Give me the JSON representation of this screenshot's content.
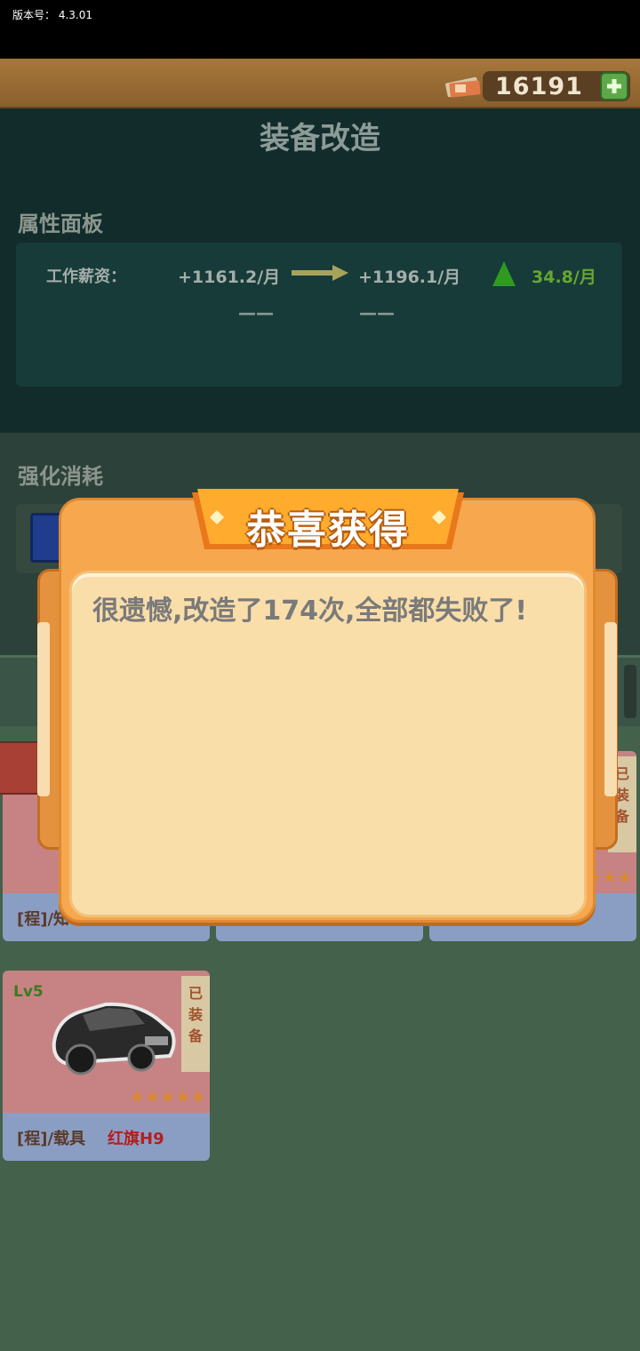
{
  "status": {
    "version_label": "版本号： 4.3.01"
  },
  "topbar": {
    "money": "16191"
  },
  "page": {
    "title": "装备改造"
  },
  "attributes": {
    "section_title": "属性面板",
    "label": "工作薪资：",
    "old_value": "+1161.2/月",
    "new_value": "+1196.1/月",
    "diff": "34.8/月",
    "dash_old": "——",
    "dash_new": "——"
  },
  "cost": {
    "section_title": "强化消耗"
  },
  "cards": [
    {
      "lv": "Lv5",
      "equipped": "已\n装\n备",
      "stars": "★★★★★",
      "type": "[程]/载具",
      "name": "红旗H9"
    }
  ],
  "partial_cards": {
    "card1_type": "[程]/知",
    "card3_equipped": "已\n装\n备"
  },
  "modal": {
    "title": "恭喜获得",
    "message": "很遗憾,改造了174次,全部都失败了!"
  },
  "colors": {
    "accent": "#f7a84f",
    "up": "#2f9a22",
    "diff_text": "#68a630"
  }
}
